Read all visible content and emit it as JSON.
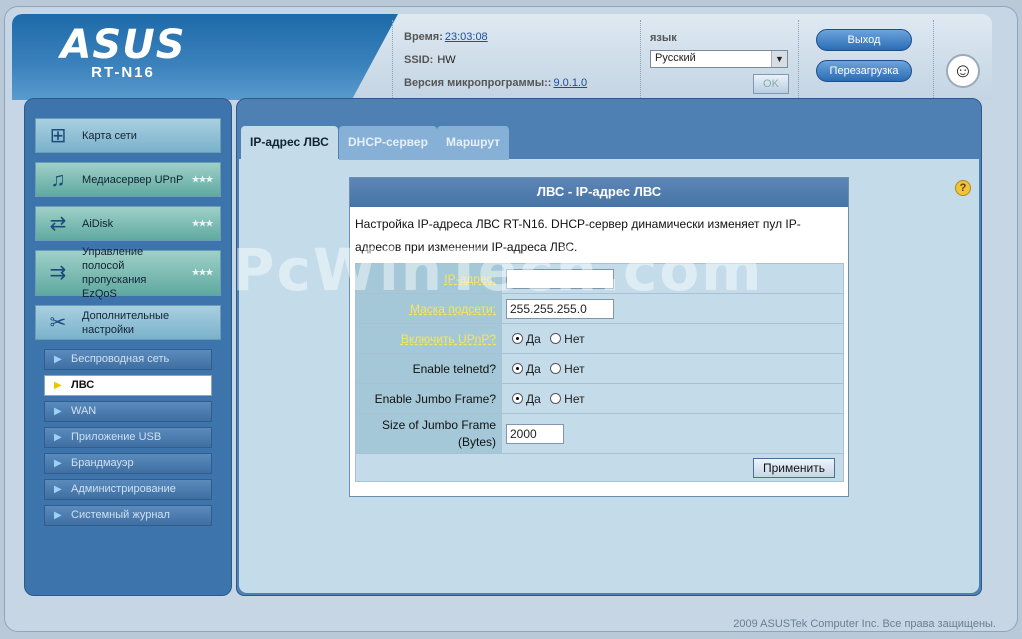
{
  "header": {
    "brand": "ASUS",
    "model": "RT-N16",
    "time_label": "Время:",
    "time_value": "23:03:08",
    "ssid_label": "SSID:",
    "ssid_value": "HW",
    "firmware_label": "Версия микропрограммы::",
    "firmware_value": "9.0.1.0",
    "language_label": "язык",
    "language_selected": "Русский",
    "ok_label": "OK",
    "logout_label": "Выход",
    "reboot_label": "Перезагрузка"
  },
  "sidebar": {
    "main_items": [
      {
        "label": "Карта сети",
        "icon": "network-map-icon"
      },
      {
        "label": "Медиасервер UPnP",
        "icon": "media-server-icon"
      },
      {
        "label": "AiDisk",
        "icon": "aidisk-icon"
      },
      {
        "label": "Управление полосой пропускания EzQoS",
        "icon": "qos-icon"
      },
      {
        "label": "Дополнительные настройки",
        "icon": "tools-icon"
      }
    ],
    "sub_items": [
      {
        "label": "Беспроводная сеть"
      },
      {
        "label": "ЛВС"
      },
      {
        "label": "WAN"
      },
      {
        "label": "Приложение USB"
      },
      {
        "label": "Брандмауэр"
      },
      {
        "label": "Администрирование"
      },
      {
        "label": "Системный журнал"
      }
    ]
  },
  "tabs": [
    {
      "label": "IP-адрес ЛВС",
      "active": true
    },
    {
      "label": "DHCP-сервер",
      "active": false
    },
    {
      "label": "Маршрут",
      "active": false
    }
  ],
  "form": {
    "title": "ЛВС - IP-адрес ЛВС",
    "description": "Настройка IP-адреса ЛВС RT-N16. DHCP-сервер динамически изменяет пул IP-адресов при изменении IP-адреса ЛВС.",
    "ip_label": "IP-адрес:",
    "ip_value": "",
    "mask_label": "Маска подсети:",
    "mask_value": "255.255.255.0",
    "upnp_label": "Включить UPnP?",
    "telnet_label": "Enable telnetd?",
    "jumbo_label": "Enable Jumbo Frame?",
    "jumbo_size_label": "Size of Jumbo Frame (Bytes)",
    "jumbo_size_value": "2000",
    "yes_label": "Да",
    "no_label": "Нет",
    "apply_label": "Применить"
  },
  "watermark": "PcWinTech.com",
  "footer": {
    "copyright": "2009 ASUSTek Computer Inc. Все права защищены."
  }
}
